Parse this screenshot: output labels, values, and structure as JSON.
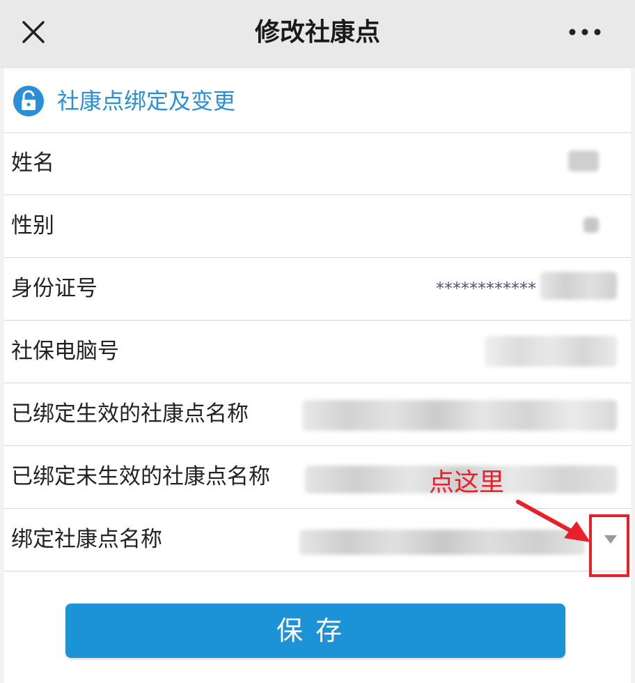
{
  "header": {
    "title": "修改社康点",
    "close_icon": "close-icon",
    "more_icon": "more-icon"
  },
  "section": {
    "icon": "lock-icon",
    "label": "社康点绑定及变更"
  },
  "fields": {
    "name": {
      "label": "姓名"
    },
    "gender": {
      "label": "性别"
    },
    "id_number": {
      "label": "身份证号",
      "masked_value": "************"
    },
    "social_security_no": {
      "label": "社保电脑号"
    },
    "bound_effective": {
      "label": "已绑定生效的社康点名称"
    },
    "bound_not_effective": {
      "label": "已绑定未生效的社康点名称"
    },
    "bind_name": {
      "label": "绑定社康点名称",
      "dropdown_icon": "chevron-down-icon"
    }
  },
  "annotation": {
    "text": "点这里",
    "color": "#e8202a"
  },
  "save_button": {
    "label": "保存"
  },
  "colors": {
    "accent": "#2a8fd8",
    "button": "#1b93d6",
    "annotation": "#e8202a"
  }
}
